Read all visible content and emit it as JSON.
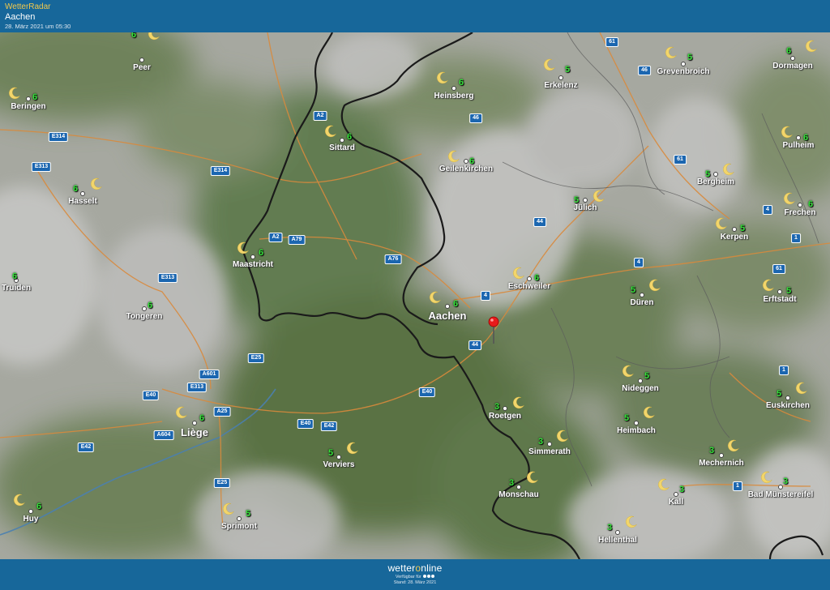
{
  "header": {
    "app_name": "WetterRadar",
    "location": "Aachen",
    "datetime": "28. März 2021 um 05:30"
  },
  "footer": {
    "brand_prefix": "wetter",
    "brand_o": "o",
    "brand_suffix": "nline",
    "available": "Verfügbar für",
    "stand": "Stand: 28. März 2021"
  },
  "map": {
    "cities": [
      {
        "name": "Peer",
        "temp": "6"
      },
      {
        "name": "Beringen",
        "temp": "6"
      },
      {
        "name": "Hasselt",
        "temp": "6"
      },
      {
        "name": "Truiden",
        "temp": "6"
      },
      {
        "name": "Tongeren",
        "temp": "6"
      },
      {
        "name": "Maastricht",
        "temp": "6"
      },
      {
        "name": "Sittard",
        "temp": "6"
      },
      {
        "name": "Heinsberg",
        "temp": "6"
      },
      {
        "name": "Erkelenz",
        "temp": "5"
      },
      {
        "name": "Grevenbroich",
        "temp": "5"
      },
      {
        "name": "Dormagen",
        "temp": "6"
      },
      {
        "name": "Geilenkirchen",
        "temp": "6"
      },
      {
        "name": "Jülich",
        "temp": "5"
      },
      {
        "name": "Bergheim",
        "temp": "5"
      },
      {
        "name": "Pulheim",
        "temp": "6"
      },
      {
        "name": "Frechen",
        "temp": "6"
      },
      {
        "name": "Kerpen",
        "temp": "5"
      },
      {
        "name": "Eschweiler",
        "temp": "6"
      },
      {
        "name": "Aachen",
        "temp": "6"
      },
      {
        "name": "Düren",
        "temp": "5"
      },
      {
        "name": "Erftstadt",
        "temp": "5"
      },
      {
        "name": "Liège",
        "temp": "6"
      },
      {
        "name": "Verviers",
        "temp": "5"
      },
      {
        "name": "Roetgen",
        "temp": "3"
      },
      {
        "name": "Nideggen",
        "temp": "5"
      },
      {
        "name": "Euskirchen",
        "temp": "5"
      },
      {
        "name": "Heimbach",
        "temp": "5"
      },
      {
        "name": "Simmerath",
        "temp": "3"
      },
      {
        "name": "Mechernich",
        "temp": "3"
      },
      {
        "name": "Monschau",
        "temp": "3"
      },
      {
        "name": "Kall",
        "temp": "3"
      },
      {
        "name": "Bad Münstereifel",
        "temp": "3"
      },
      {
        "name": "Huy",
        "temp": "6"
      },
      {
        "name": "Sprimont",
        "temp": "5"
      },
      {
        "name": "Hellenthal",
        "temp": "3"
      }
    ],
    "road_labels": [
      "61",
      "46",
      "A2",
      "46",
      "E314",
      "E313",
      "E314",
      "61",
      "4",
      "44",
      "A2",
      "A79",
      "A76",
      "E313",
      "4",
      "1",
      "61",
      "4",
      "44",
      "E25",
      "A601",
      "E313",
      "E40",
      "E40",
      "E40",
      "E42",
      "A25",
      "A604",
      "E42",
      "1",
      "E25",
      "1"
    ],
    "weather_icon": "moon-icon",
    "marker_icon": "location-pin-icon",
    "colors": {
      "temp": "#35e23a",
      "road": "#d98a3c",
      "border": "#1a1a1a",
      "header": "#17679a"
    }
  }
}
